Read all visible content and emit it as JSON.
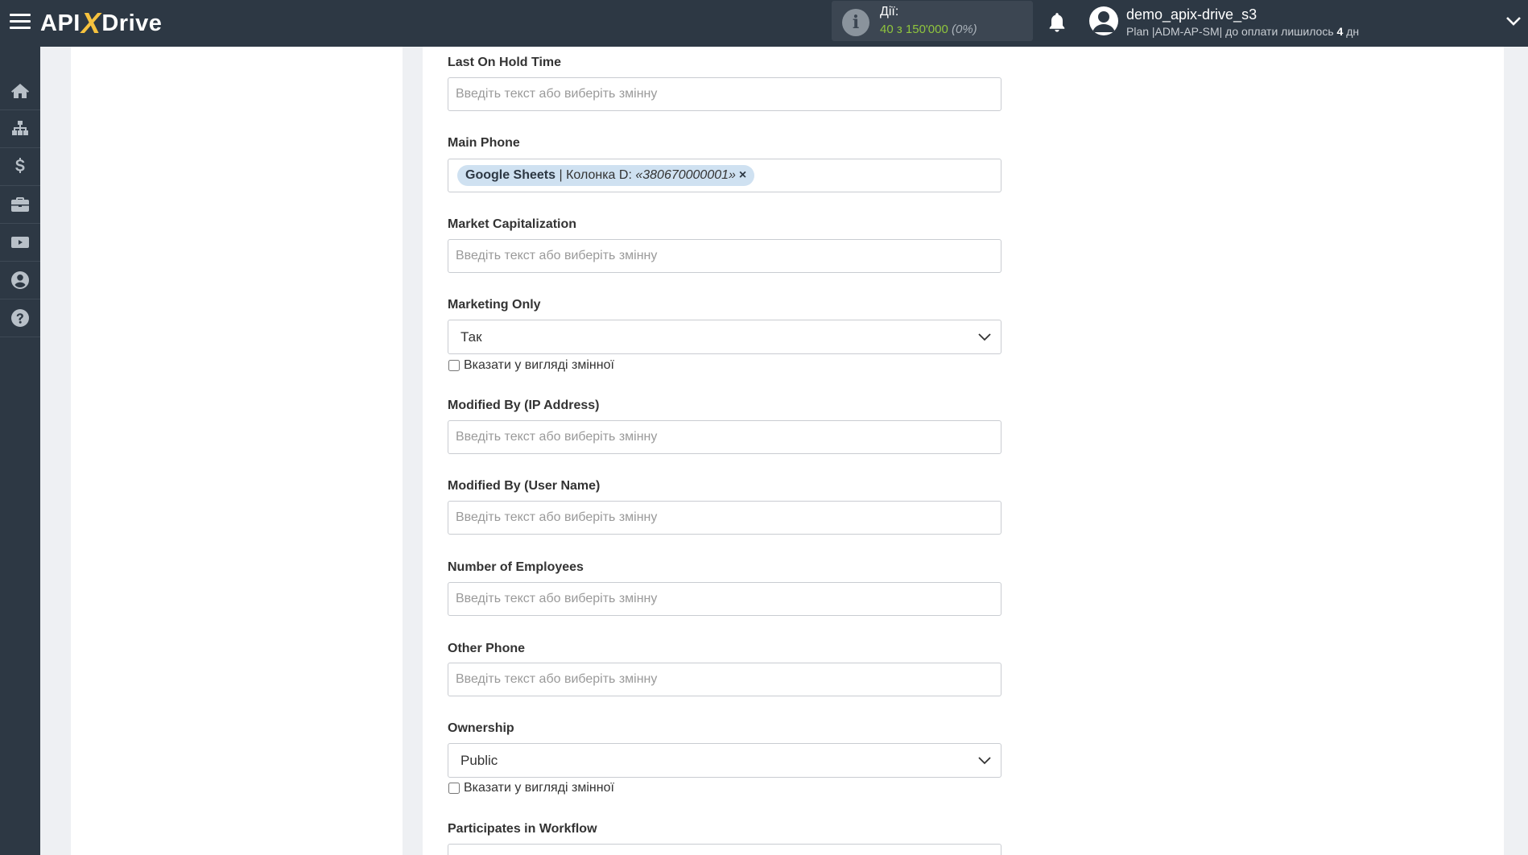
{
  "header": {
    "logo_api": "API",
    "logo_x": "X",
    "logo_drive": "Drive",
    "actions_label": "Дії:",
    "actions_count": "40 з 150'000",
    "actions_percent": "(0%)",
    "user_name": "demo_apix-drive_s3",
    "user_plan_prefix": "Plan |ADM-AP-SM| до оплати лишилось",
    "user_plan_days": "4",
    "user_plan_suffix": "дн"
  },
  "sidebar": {
    "items": [
      "home-icon",
      "sitemap-icon",
      "dollar-icon",
      "briefcase-icon",
      "youtube-icon",
      "user-icon",
      "help-icon"
    ]
  },
  "placeholder": "Введіть текст або виберіть змінну",
  "checkbox_label": "Вказати у вигляді змінної",
  "fields": {
    "last_on_hold": {
      "label": "Last On Hold Time"
    },
    "main_phone": {
      "label": "Main Phone",
      "tag_source": "Google Sheets",
      "tag_column": " | Колонка D: ",
      "tag_value": "«380670000001»",
      "tag_remove": "×"
    },
    "market_cap": {
      "label": "Market Capitalization"
    },
    "marketing_only": {
      "label": "Marketing Only",
      "value": "Так"
    },
    "modified_ip": {
      "label": "Modified By (IP Address)"
    },
    "modified_user": {
      "label": "Modified By (User Name)"
    },
    "num_employees": {
      "label": "Number of Employees"
    },
    "other_phone": {
      "label": "Other Phone"
    },
    "ownership": {
      "label": "Ownership",
      "value": "Public"
    },
    "participates": {
      "label": "Participates in Workflow"
    }
  }
}
